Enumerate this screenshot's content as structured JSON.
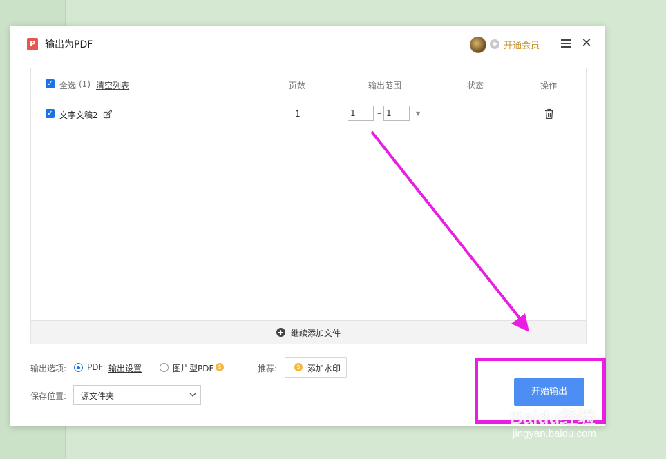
{
  "dialog": {
    "title": "输出为PDF",
    "vip_label": "开通会员"
  },
  "table": {
    "headers": {
      "select_all": "全选",
      "count": "(1)",
      "clear_list": "清空列表",
      "pages": "页数",
      "range": "输出范围",
      "status": "状态",
      "actions": "操作"
    },
    "rows": [
      {
        "name": "文字文稿2",
        "pages": "1",
        "range_from": "1",
        "range_to": "1",
        "status": ""
      }
    ],
    "add_more": "继续添加文件"
  },
  "options": {
    "output_label": "输出选项:",
    "pdf_label": "PDF",
    "output_settings": "输出设置",
    "image_pdf_label": "图片型PDF",
    "recommend_label": "推荐:",
    "watermark_button": "添加水印",
    "save_location_label": "保存位置:",
    "save_location_value": "源文件夹",
    "start_button": "开始输出"
  },
  "watermark": {
    "brand": "Baidu经验",
    "url": "jingyan.baidu.com"
  },
  "colors": {
    "accent": "#4d8ef5",
    "annotation": "#e81ee0",
    "vip": "#c8922a"
  }
}
